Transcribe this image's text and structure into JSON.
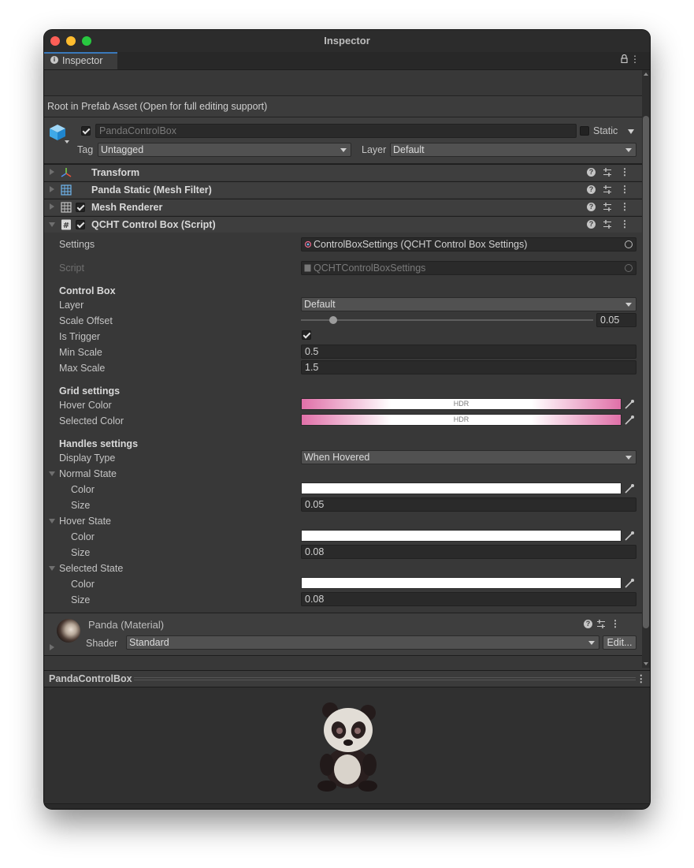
{
  "window": {
    "title": "Inspector"
  },
  "tab": {
    "label": "Inspector"
  },
  "prefab_info": "Root in Prefab Asset (Open for full editing support)",
  "gameobject": {
    "name": "PandaControlBox",
    "static_label": "Static",
    "tag_label": "Tag",
    "tag_value": "Untagged",
    "layer_label": "Layer",
    "layer_value": "Default"
  },
  "components": [
    {
      "title": "Transform"
    },
    {
      "title": "Panda Static (Mesh Filter)"
    },
    {
      "title": "Mesh Renderer"
    },
    {
      "title": "QCHT Control Box (Script)"
    }
  ],
  "help_glyph": "?",
  "kebab_glyph": "⋮",
  "script_component": {
    "settings_label": "Settings",
    "settings_value": "ControlBoxSettings (QCHT Control Box Settings)",
    "script_label": "Script",
    "script_value": "QCHTControlBoxSettings",
    "control_box_header": "Control Box",
    "layer_label": "Layer",
    "layer_value": "Default",
    "scale_offset_label": "Scale Offset",
    "scale_offset_value": "0.05",
    "scale_offset_fraction": 0.05,
    "is_trigger_label": "Is Trigger",
    "is_trigger_checked": true,
    "min_scale_label": "Min Scale",
    "min_scale_value": "0.5",
    "max_scale_label": "Max Scale",
    "max_scale_value": "1.5",
    "grid_header": "Grid settings",
    "hover_color_label": "Hover Color",
    "selected_color_label": "Selected Color",
    "hdr_text": "HDR",
    "grid_color": "#e070a8",
    "handles_header": "Handles settings",
    "display_type_label": "Display Type",
    "display_type_value": "When Hovered",
    "normal_state_label": "Normal State",
    "hover_state_label": "Hover State",
    "selected_state_label": "Selected State",
    "color_label": "Color",
    "size_label": "Size",
    "normal_size": "0.05",
    "hover_size": "0.08",
    "selected_size": "0.08"
  },
  "material": {
    "name": "Panda (Material)",
    "shader_label": "Shader",
    "shader_value": "Standard",
    "edit_label": "Edit..."
  },
  "preview": {
    "title": "PandaControlBox"
  },
  "colors": {
    "accent": "#3a79bb",
    "panel": "#383838",
    "header": "#3e3e3e",
    "white_swatch": "#ffffff"
  }
}
